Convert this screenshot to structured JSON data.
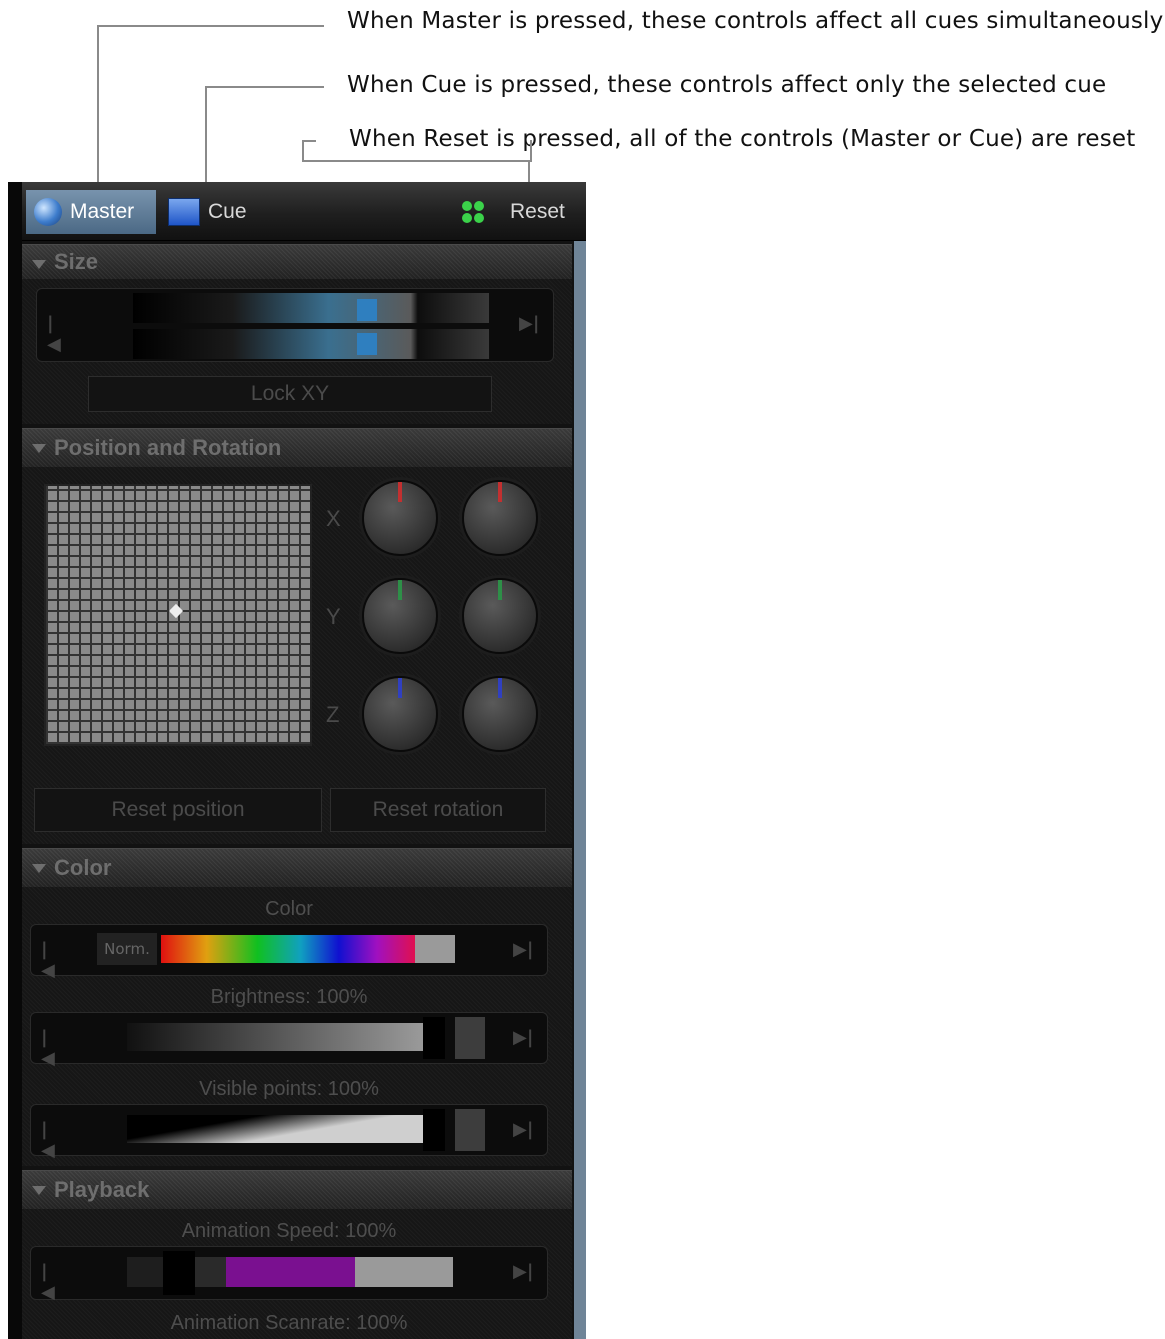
{
  "callouts": {
    "master": "When Master is pressed, these controls affect all cues simultaneously",
    "cue": "When Cue is pressed, these controls affect only the selected cue",
    "reset": "When Reset is pressed, all of the controls (Master or Cue) are reset"
  },
  "tabs": {
    "master": "Master",
    "cue": "Cue",
    "reset": "Reset"
  },
  "sections": {
    "size": {
      "title": "Size",
      "lock_button": "Lock XY"
    },
    "position": {
      "title": "Position and Rotation",
      "axes": [
        "X",
        "Y",
        "Z"
      ],
      "reset_position": "Reset position",
      "reset_rotation": "Reset rotation"
    },
    "color": {
      "title": "Color",
      "color_label": "Color",
      "norm_label": "Norm.",
      "brightness_label": "Brightness: 100%",
      "visible_points_label": "Visible points: 100%"
    },
    "playback": {
      "title": "Playback",
      "speed_label": "Animation Speed: 100%",
      "scanrate_label": "Animation Scanrate: 100%"
    }
  },
  "colors": {
    "master_tab": "#5f7d9a",
    "knob_x": "#c23030",
    "knob_y": "#2e8f48",
    "knob_z": "#3040c0"
  }
}
